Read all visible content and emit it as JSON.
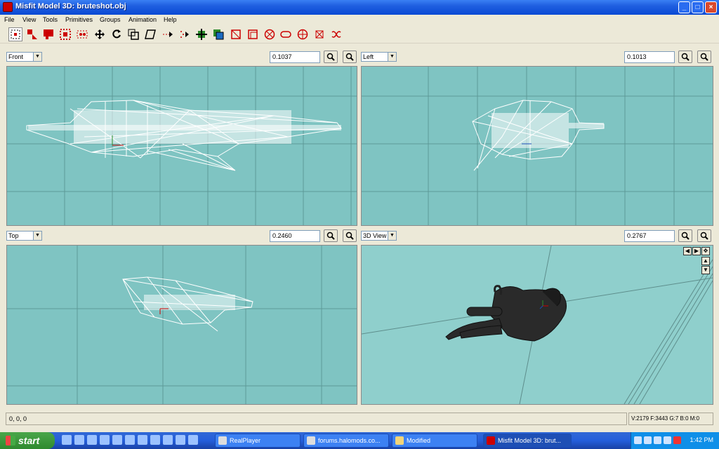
{
  "window": {
    "title": "Misfit Model 3D: bruteshot.obj"
  },
  "menu": [
    "File",
    "View",
    "Tools",
    "Primitives",
    "Groups",
    "Animation",
    "Help"
  ],
  "toolbar": [
    {
      "name": "select-vertices-tool",
      "icon": "select-vertices-icon"
    },
    {
      "name": "select-faces-tool",
      "icon": "select-faces-icon"
    },
    {
      "name": "select-connected-tool",
      "icon": "select-connected-icon"
    },
    {
      "name": "select-groups-tool",
      "icon": "select-groups-icon"
    },
    {
      "name": "select-bone-joints-tool",
      "icon": "select-joints-icon"
    },
    {
      "name": "move-tool",
      "icon": "move-icon"
    },
    {
      "name": "rotate-tool",
      "icon": "rotate-icon"
    },
    {
      "name": "scale-tool",
      "icon": "scale-icon"
    },
    {
      "name": "shear-tool",
      "icon": "shear-icon"
    },
    {
      "name": "extrude-tool",
      "icon": "extrude-icon"
    },
    {
      "name": "attract-tool",
      "icon": "attract-icon"
    },
    {
      "name": "add-vertex-tool",
      "icon": "add-vertex-icon"
    },
    {
      "name": "add-rectangle-tool",
      "icon": "rectangle-icon"
    },
    {
      "name": "create-cube-tool",
      "icon": "cube-icon"
    },
    {
      "name": "create-ellipsoid-tool",
      "icon": "ellipsoid-icon"
    },
    {
      "name": "create-cylinder-tool",
      "icon": "cylinder-icon"
    },
    {
      "name": "create-torus-tool",
      "icon": "torus-icon"
    },
    {
      "name": "add-bone-tool",
      "icon": "bone-icon"
    },
    {
      "name": "add-point-tool",
      "icon": "point-icon"
    }
  ],
  "viewports": {
    "top_left": {
      "view": "Front",
      "zoom": "0.1037"
    },
    "top_right": {
      "view": "Left",
      "zoom": "0.1013"
    },
    "bottom_left": {
      "view": "Top",
      "zoom": "0.2460"
    },
    "bottom_right": {
      "view": "3D View",
      "zoom": "0.2767"
    }
  },
  "status": {
    "coords": "0, 0, 0",
    "stats": "V:2179 F:3443 G:7 B:0 M:0"
  },
  "taskbar": {
    "start": "start",
    "tasks": [
      "RealPlayer",
      "forums.halomods.co...",
      "Modified",
      "Misfit Model 3D: brut..."
    ],
    "clock": "1:42 PM"
  }
}
